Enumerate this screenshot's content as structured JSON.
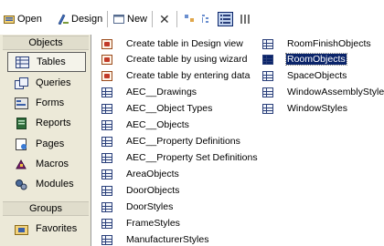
{
  "toolbar": {
    "open_label": "Open",
    "design_label": "Design",
    "new_label": "New",
    "delete_symbol": "✕"
  },
  "objects_bar": {
    "objects_header": "Objects",
    "groups_header": "Groups",
    "items": [
      {
        "label": "Tables",
        "icon": "table-icon",
        "selected": true
      },
      {
        "label": "Queries",
        "icon": "query-icon"
      },
      {
        "label": "Forms",
        "icon": "form-icon"
      },
      {
        "label": "Reports",
        "icon": "report-icon"
      },
      {
        "label": "Pages",
        "icon": "page-icon"
      },
      {
        "label": "Macros",
        "icon": "macro-icon"
      },
      {
        "label": "Modules",
        "icon": "module-icon"
      }
    ],
    "groups": [
      {
        "label": "Favorites",
        "icon": "favorites-icon"
      }
    ]
  },
  "list": {
    "column1": [
      {
        "label": "Create table in Design view",
        "icon": "design-wizard-icon"
      },
      {
        "label": "Create table by using wizard",
        "icon": "design-wizard-icon"
      },
      {
        "label": "Create table by entering data",
        "icon": "design-wizard-icon"
      },
      {
        "label": "AEC__Drawings",
        "icon": "table-icon"
      },
      {
        "label": "AEC__Object Types",
        "icon": "table-icon"
      },
      {
        "label": "AEC__Objects",
        "icon": "table-icon"
      },
      {
        "label": "AEC__Property Definitions",
        "icon": "table-icon"
      },
      {
        "label": "AEC__Property Set Definitions",
        "icon": "table-icon"
      },
      {
        "label": "AreaObjects",
        "icon": "table-icon"
      },
      {
        "label": "DoorObjects",
        "icon": "table-icon"
      },
      {
        "label": "DoorStyles",
        "icon": "table-icon"
      },
      {
        "label": "FrameStyles",
        "icon": "table-icon"
      },
      {
        "label": "ManufacturerStyles",
        "icon": "table-icon"
      }
    ],
    "column2": [
      {
        "label": "RoomFinishObjects",
        "icon": "table-icon"
      },
      {
        "label": "RoomObjects",
        "icon": "table-icon",
        "selected": true
      },
      {
        "label": "SpaceObjects",
        "icon": "table-icon"
      },
      {
        "label": "WindowAssemblyStyles",
        "icon": "table-icon"
      },
      {
        "label": "WindowStyles",
        "icon": "table-icon"
      }
    ]
  },
  "colors": {
    "selection": "#0a246a",
    "panel": "#ece9d8"
  }
}
